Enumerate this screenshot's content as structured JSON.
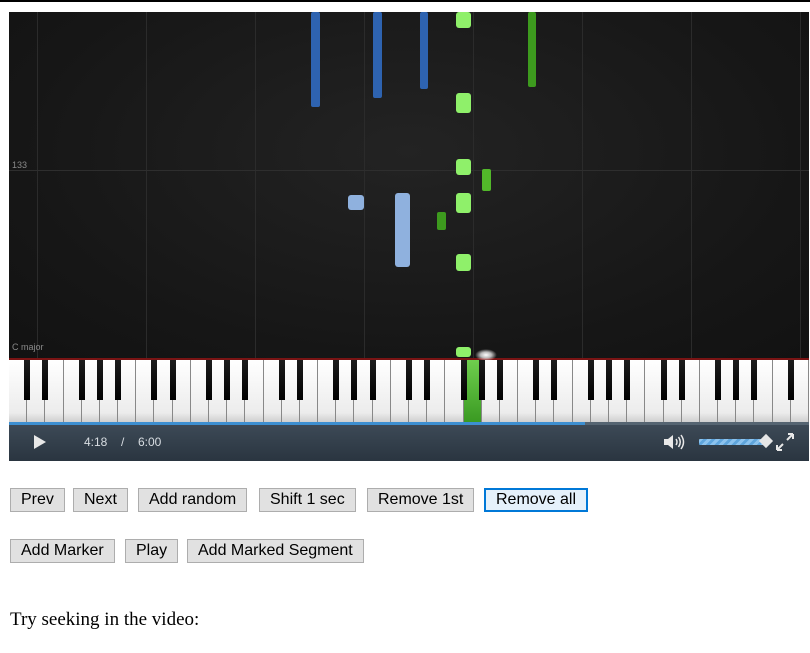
{
  "video": {
    "key_label": "C major",
    "measure_label": "133",
    "current_time": "4:18",
    "separator": "/",
    "duration": "6:00",
    "progress_fraction": 0.72,
    "volume_fraction": 0.95,
    "colors": {
      "accent": "#3d8fd1",
      "note_blue_dark": "#2e63b0",
      "note_blue_light": "#8fb1de",
      "note_green_light": "#8ff06a",
      "note_green_dark": "#3d9a1e"
    }
  },
  "buttons_row1": {
    "prev": "Prev",
    "next": "Next",
    "add_random": "Add random",
    "shift": "Shift 1 sec",
    "remove_first": "Remove 1st",
    "remove_all": "Remove all"
  },
  "buttons_row2": {
    "add_marker": "Add Marker",
    "play": "Play",
    "add_segment": "Add Marked Segment"
  },
  "caption": "Try seeking in the video:"
}
